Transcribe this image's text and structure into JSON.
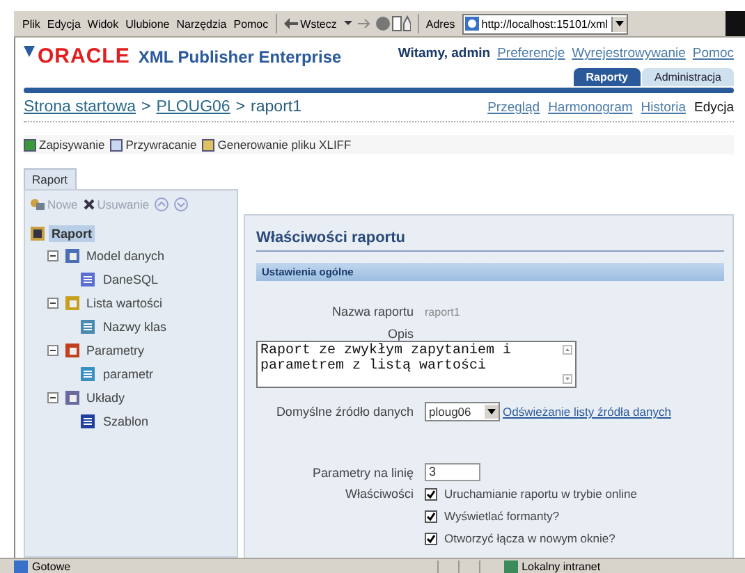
{
  "browser": {
    "menu": [
      "Plik",
      "Edycja",
      "Widok",
      "Ulubione",
      "Narzędzia",
      "Pomoc"
    ],
    "back": "Wstecz",
    "address_label": "Adres",
    "url": "http://localhost:15101/xml"
  },
  "header": {
    "brand": "ORACLE",
    "product": "XML Publisher Enterprise",
    "welcome": "Witamy, admin",
    "links": [
      "Preferencje",
      "Wyrejestrowywanie",
      "Pomoc"
    ],
    "tabs": [
      {
        "label": "Raporty",
        "selected": true
      },
      {
        "label": "Administracja",
        "selected": false
      }
    ]
  },
  "breadcrumb": [
    {
      "label": "Strona startowa",
      "separator": ">"
    },
    {
      "label": "PLOUG06",
      "separator": ">"
    },
    {
      "label": "raport1"
    }
  ],
  "subnav": [
    {
      "label": "Przegląd",
      "selected": false
    },
    {
      "label": "Harmonogram",
      "selected": false
    },
    {
      "label": "Historia",
      "selected": false
    },
    {
      "label": "Edycja",
      "selected": true
    }
  ],
  "toolbar": [
    "Zapisywanie",
    "Przywracanie",
    "Generowanie pliku XLIFF"
  ],
  "panel_tab": {
    "label": "Raport",
    "selected": true
  },
  "tree_toolbar": [
    {
      "label": "Nowe",
      "disabled": true
    },
    {
      "label": "Usuwanie",
      "disabled": true
    }
  ],
  "tree": [
    {
      "label": "Raport",
      "selected": true,
      "children": [
        {
          "label": "Model danych",
          "expanded": true,
          "children": [
            {
              "label": "DaneSQL"
            }
          ]
        },
        {
          "label": "Lista wartości",
          "expanded": true,
          "children": [
            {
              "label": "Nazwy klas"
            }
          ]
        },
        {
          "label": "Parametry",
          "expanded": true,
          "children": [
            {
              "label": "parametr"
            }
          ]
        },
        {
          "label": "Układy",
          "expanded": true,
          "children": [
            {
              "label": "Szablon"
            }
          ]
        }
      ]
    }
  ],
  "properties": {
    "title": "Właściwości raportu",
    "section": "Ustawienia ogólne",
    "name_label": "Nazwa raportu",
    "name_value": "raport1",
    "description_label": "Opis",
    "description": "Raport ze zwykłym zapytaniem i parametrem z listą wartości",
    "source_label": "Domyślne źródło danych",
    "source_value": "ploug06",
    "refresh_link": "Odświeżanie listy źródła danych",
    "params_label": "Parametry na linię",
    "params_value": "3",
    "options_label": "Właściwości",
    "options": [
      {
        "label": "Uruchamianie raportu w trybie online",
        "checked": true
      },
      {
        "label": "Wyświetlać formanty?",
        "checked": true
      },
      {
        "label": "Otworzyć łącza w nowym oknie?",
        "checked": true
      }
    ]
  },
  "status_bar": {
    "text": "Gotowe",
    "zone": "Lokalny intranet"
  }
}
